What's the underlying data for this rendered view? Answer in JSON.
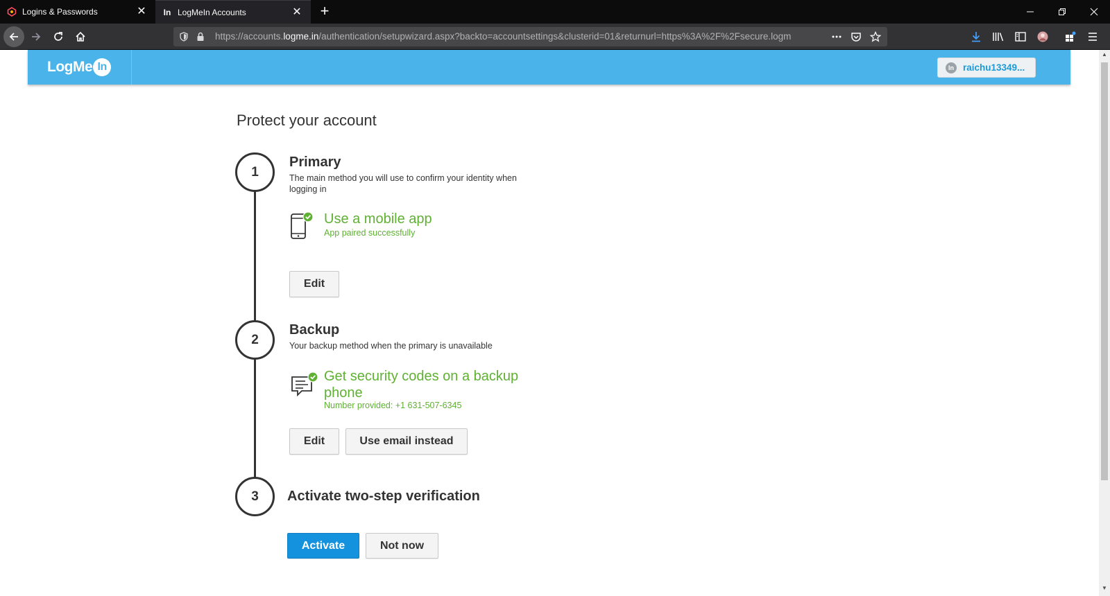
{
  "browser": {
    "tabs": [
      {
        "title": "Logins & Passwords",
        "icon": "lockwise-icon",
        "active": false
      },
      {
        "title": "LogMeIn Accounts",
        "icon": "logmein-favicon-icon",
        "active": true
      }
    ],
    "url_prefix": "https://accounts.",
    "url_host": "logme.in",
    "url_rest": "/authentication/setupwizard.aspx?backto=accountsettings&clusterid=01&returnurl=https%3A%2F%2Fsecure.logm",
    "colors": {
      "tabbar": "#0c0c0d",
      "navbar": "#323234",
      "urlbar": "#474749"
    }
  },
  "header": {
    "logo_text": "LogMe",
    "logo_badge": "In",
    "user_label": "raichu13349...",
    "user_icon_text": "In",
    "colors": {
      "header": "#4ab3ea"
    }
  },
  "main": {
    "title": "Protect your account",
    "steps": [
      {
        "number": "1",
        "title": "Primary",
        "description": "The main method you will use to confirm your identity when logging in",
        "method_title": "Use a mobile app",
        "method_status": "App paired successfully",
        "method_icon": "mobile-phone-check-icon",
        "buttons": [
          "Edit"
        ]
      },
      {
        "number": "2",
        "title": "Backup",
        "description": "Your backup method when the primary is unavailable",
        "method_title": "Get security codes on a backup phone",
        "method_status": "Number provided: +1 631-507-6345",
        "method_icon": "sms-message-check-icon",
        "buttons": [
          "Edit",
          "Use email instead"
        ]
      },
      {
        "number": "3",
        "title": "Activate two-step verification",
        "buttons": [
          "Activate",
          "Not now"
        ]
      }
    ],
    "colors": {
      "success": "#5fb033",
      "primary_button": "#1592dd",
      "text": "#333333"
    }
  }
}
